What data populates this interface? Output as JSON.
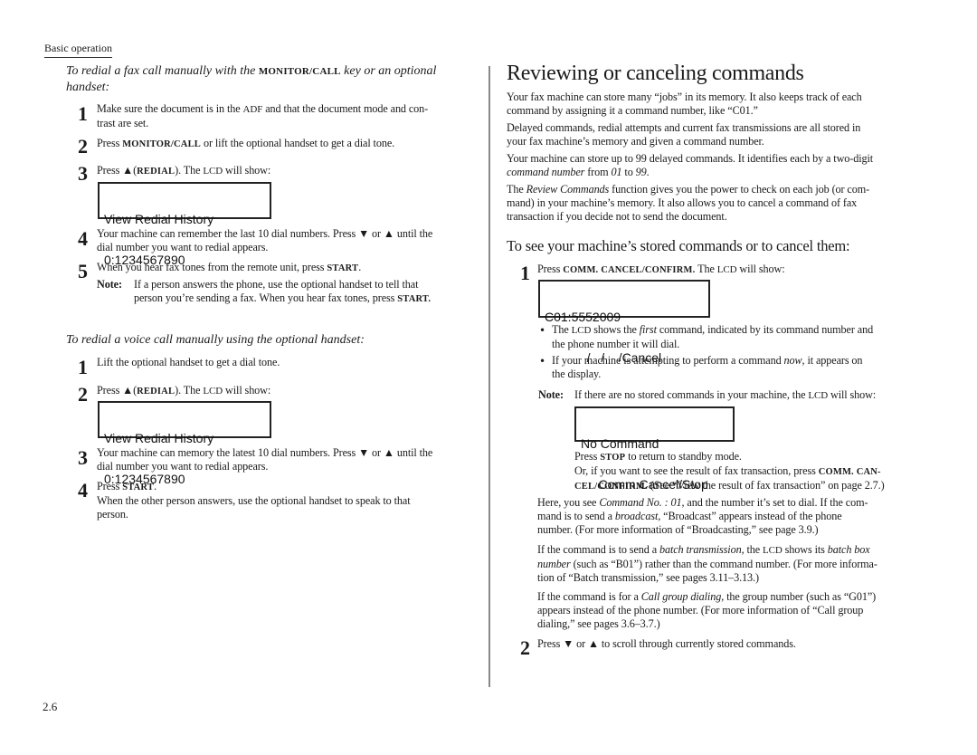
{
  "header": {
    "section_label": "Basic operation"
  },
  "footer": {
    "page_number": "2.6"
  },
  "left": {
    "fax_section": {
      "title_a": "To redial a fax call manually with the ",
      "title_key": "MONITOR/CALL",
      "title_b": " key or an optional",
      "title_c": "handset:",
      "steps": [
        {
          "num": "1",
          "l1a": "Make sure the document is in the ",
          "l1sc": "ADF",
          "l1b": " and that the document mode and con-",
          "l2": "trast  are set."
        },
        {
          "num": "2",
          "a": "Press ",
          "key": "MONITOR/CALL",
          "b": " or lift the optional handset to get a dial tone."
        },
        {
          "num": "3",
          "a": "Press ▲(",
          "key": "REDIAL",
          "b": "). The ",
          "sc": "LCD",
          "c": " will show:"
        },
        {
          "num": "4",
          "l1": "Your machine can remember the last 10 dial numbers. Press ▼ or ▲ until the",
          "l2": "dial number you want to redial appears."
        },
        {
          "num": "5",
          "a": "When you hear fax tones from the remote unit, press ",
          "key": "START",
          "b": "."
        }
      ],
      "lcd": {
        "line1": "View Redial History",
        "line2": "0:1234567890"
      },
      "note": {
        "label": "Note:",
        "l1": "If a person answers the phone, use the optional handset to tell that",
        "l2a": "person you’re sending a fax. When you hear fax tones, press ",
        "l2key": "START."
      }
    },
    "voice_section": {
      "title": "To redial a voice call manually using the optional handset:",
      "steps": [
        {
          "num": "1",
          "text": "Lift the optional handset to get a dial tone."
        },
        {
          "num": "2",
          "a": "Press ▲(",
          "key": "REDIAL",
          "b": "). The ",
          "sc": "LCD",
          "c": " will show:"
        },
        {
          "num": "3",
          "l1": "Your machine can memory the latest 10 dial numbers. Press ▼ or ▲ until the",
          "l2": "dial number you want to redial appears."
        },
        {
          "num": "4",
          "a": "Press ",
          "key": "START",
          "b": ".",
          "l2": "When the other person answers, use the optional handset to speak to that",
          "l3": "person."
        }
      ],
      "lcd": {
        "line1": "View Redial History",
        "line2": "0:1234567890"
      }
    }
  },
  "right": {
    "title": "Reviewing or canceling commands",
    "paras": [
      {
        "l1": "Your fax machine can store many “jobs” in its memory. It also keeps track of each",
        "l2": "command by assigning it a command number, like “C01.”"
      },
      {
        "l1": "Delayed commands, redial attempts and current fax transmissions are all stored in",
        "l2": "your fax machine’s memory and given a command number."
      },
      {
        "l1": "Your machine can store up to 99 delayed commands. It identifies each by a two-digit",
        "l2it": "command number",
        "l2b": " from ",
        "l2c": "01",
        "l2d": " to ",
        "l2e": "99",
        "l2f": "."
      },
      {
        "l1a": "The ",
        "l1it": "Review Commands",
        "l1b": " function gives you the power to check on each job (or com-",
        "l2": "mand) in your machine’s memory. It also allows you to cancel a command of fax",
        "l3": "transaction if you decide not to send the document."
      }
    ],
    "subtitle": "To see your machine’s stored commands or to cancel them:",
    "step1": {
      "num": "1",
      "a": "Press ",
      "key": "COMM. CANCEL/CONFIRM.",
      "b": " The ",
      "sc": "LCD",
      "c": " will show:"
    },
    "lcd1": {
      "line1": "C01:5552009",
      "line2": "            /   /    /Cancel"
    },
    "bullets": [
      {
        "a": "The ",
        "sc": "LCD",
        "b": " shows the ",
        "it": "first",
        "c": " command, indicated by its command number and",
        "l2": "the phone number it will dial."
      },
      {
        "a": "If your machine is attempting to perform a command ",
        "it": "now",
        "b": ", it appears on",
        "l2": "the display."
      }
    ],
    "note": {
      "label": "Note:",
      "a": "If there are no stored commands in your machine, the ",
      "sc": "LCD",
      "b": " will show:"
    },
    "lcd2": {
      "line1": "No Command",
      "line2": "     Comm.Cancel/Stop"
    },
    "stop_text": {
      "l1a": "Press ",
      "l1key": "STOP",
      "l1b": " to return to standby mode.",
      "l2a": "Or, if you want to see the result of fax transaction, press ",
      "l2key": "COMM. CAN-",
      "l3key": "CEL/CONFIRM.",
      "l3b": " (See “View the result of fax transaction” on page 2.7.)"
    },
    "here_para": {
      "l1a": "Here, you see ",
      "l1it": "Command No. : 01,",
      "l1b": " and the number it’s set to dial. If the com-",
      "l2a": "mand is to send a ",
      "l2it": "broadcast",
      "l2b": ", “Broadcast” appears instead of the phone",
      "l3": "number. (For more information of “Broadcasting,” see page 3.9.)"
    },
    "batch_para": {
      "l1a": "If the command is to send a ",
      "l1it": "batch transmission,",
      "l1b": " the ",
      "l1sc": "LCD",
      "l1c": " shows its ",
      "l1it2": "batch box",
      "l2it": "number",
      "l2b": " (such as “B01”) rather than the command number. (For more informa-",
      "l3": "tion of “Batch transmission,” see pages 3.11–3.13.)"
    },
    "group_para": {
      "l1a": "If the command is for a ",
      "l1it": "Call group dialing",
      "l1b": ", the group number (such as “G01”)",
      "l2": "appears instead of the phone number. (For more information of “Call group",
      "l3": "dialing,” see pages 3.6–3.7.)"
    },
    "step2": {
      "num": "2",
      "text": "Press ▼ or ▲ to scroll through currently stored commands."
    }
  }
}
